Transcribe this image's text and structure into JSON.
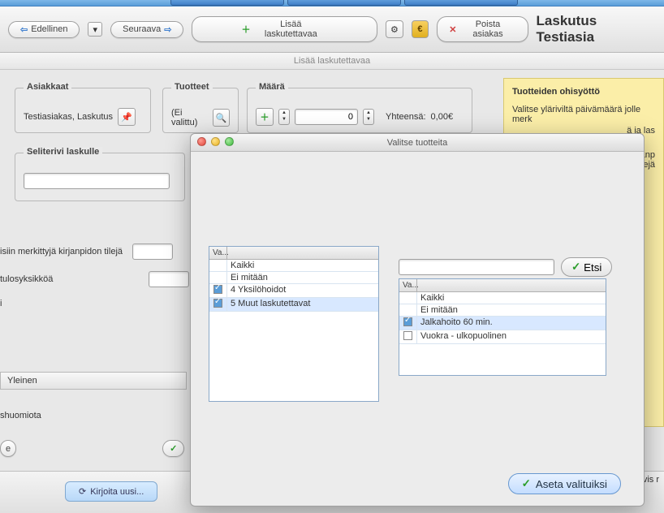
{
  "toolbar": {
    "prev_label": "Edellinen",
    "next_label": "Seuraava",
    "add_billable_label": "Lisää laskutettavaa",
    "remove_customer_label": "Poista asiakas",
    "page_title": "Laskutus Testiasia"
  },
  "subheader": "Lisää laskutettavaa",
  "customers": {
    "legend": "Asiakkaat",
    "value": "Testiasiakas, Laskutus"
  },
  "products": {
    "legend": "Tuotteet",
    "value": "(Ei valittu)"
  },
  "amount": {
    "legend": "Määrä",
    "value": "0",
    "total_label": "Yhteensä:",
    "total_value": "0,00€"
  },
  "desc_row": {
    "legend": "Seliterivi laskulle",
    "value": ""
  },
  "info": {
    "title": "Tuotteiden ohisyöttö",
    "line1": "Valitse yläriviltä päivämäärä jolle merk",
    "line2_a": "ä ja las",
    "line3": "kirjanp",
    "line4": "n tilejä"
  },
  "left_fragments": {
    "l1": "isiin merkittyjä kirjanpidon tilejä",
    "l2": "tulosyksikköä",
    "l3": "i",
    "yleinen": "Yleinen",
    "huomiota": "shuomiota",
    "tiivis": "Tiivis r"
  },
  "footer": {
    "kirjoita_label": "Kirjoita uusi..."
  },
  "modal": {
    "title": "Valitse tuotteita",
    "col_header": "Va...",
    "left_list": [
      {
        "checked": false,
        "label": "Kaikki"
      },
      {
        "checked": false,
        "label": "Ei mitään"
      },
      {
        "checked": true,
        "label": "4 Yksilöhoidot"
      },
      {
        "checked": true,
        "label": "5 Muut laskutettavat"
      }
    ],
    "right_list": [
      {
        "checked": false,
        "label": "Kaikki"
      },
      {
        "checked": false,
        "label": "Ei mitään"
      },
      {
        "checked": true,
        "label": "Jalkahoito 60 min."
      },
      {
        "checked": false,
        "label": "Vuokra - ulkopuolinen"
      }
    ],
    "search_value": "",
    "search_btn": "Etsi",
    "apply_btn": "Aseta valituiksi"
  }
}
